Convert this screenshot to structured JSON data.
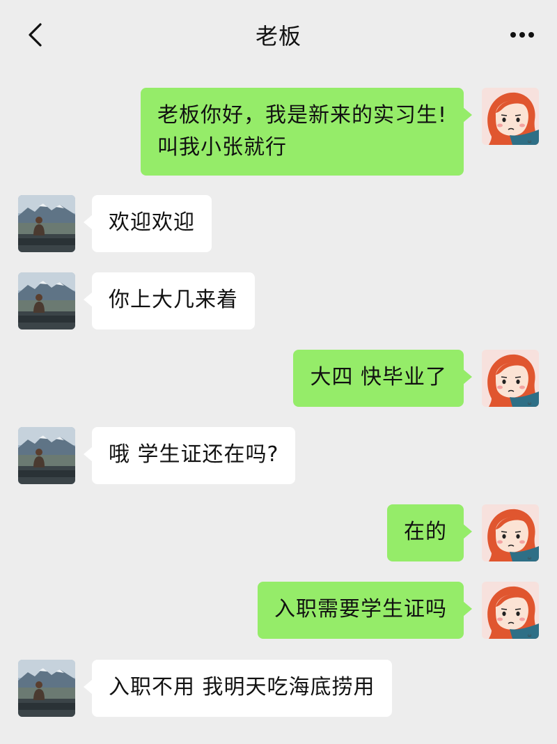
{
  "header": {
    "title": "老板",
    "back_icon": "chevron-left-icon",
    "more_icon": "more-dots-icon"
  },
  "messages": [
    {
      "side": "right",
      "text": "老板你好，我是新来的实习生!\n叫我小张就行"
    },
    {
      "side": "left",
      "text": "欢迎欢迎"
    },
    {
      "side": "left",
      "text": "你上大几来着"
    },
    {
      "side": "right",
      "text": "大四 快毕业了"
    },
    {
      "side": "left",
      "text": "哦 学生证还在吗?"
    },
    {
      "side": "right",
      "text": "在的"
    },
    {
      "side": "right",
      "text": "入职需要学生证吗"
    },
    {
      "side": "left",
      "text": "入职不用 我明天吃海底捞用"
    }
  ],
  "colors": {
    "background": "#ededed",
    "sent_bubble": "#95ec69",
    "received_bubble": "#ffffff"
  }
}
